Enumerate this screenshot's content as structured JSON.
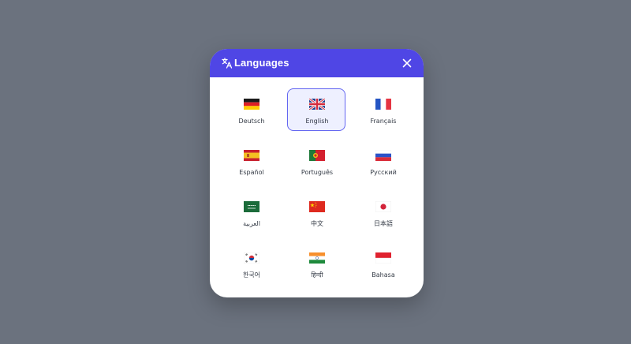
{
  "dialog": {
    "title": "Languages",
    "header_color": "#4f46e5",
    "title_icon": "translate-icon",
    "close_icon": "close-icon"
  },
  "languages": [
    {
      "label": "Deutsch",
      "flag": "germany-flag-icon",
      "selected": false
    },
    {
      "label": "English",
      "flag": "united-kingdom-flag-icon",
      "selected": true
    },
    {
      "label": "Français",
      "flag": "france-flag-icon",
      "selected": false
    },
    {
      "label": "Español",
      "flag": "spain-flag-icon",
      "selected": false
    },
    {
      "label": "Português",
      "flag": "portugal-flag-icon",
      "selected": false
    },
    {
      "label": "Русский",
      "flag": "russia-flag-icon",
      "selected": false
    },
    {
      "label": "العربية",
      "flag": "saudi-arabia-flag-icon",
      "selected": false
    },
    {
      "label": "中文",
      "flag": "china-flag-icon",
      "selected": false
    },
    {
      "label": "日本語",
      "flag": "japan-flag-icon",
      "selected": false
    },
    {
      "label": "한국어",
      "flag": "south-korea-flag-icon",
      "selected": false
    },
    {
      "label": "हिन्दी",
      "flag": "india-flag-icon",
      "selected": false
    },
    {
      "label": "Bahasa",
      "flag": "indonesia-flag-icon",
      "selected": false
    }
  ]
}
